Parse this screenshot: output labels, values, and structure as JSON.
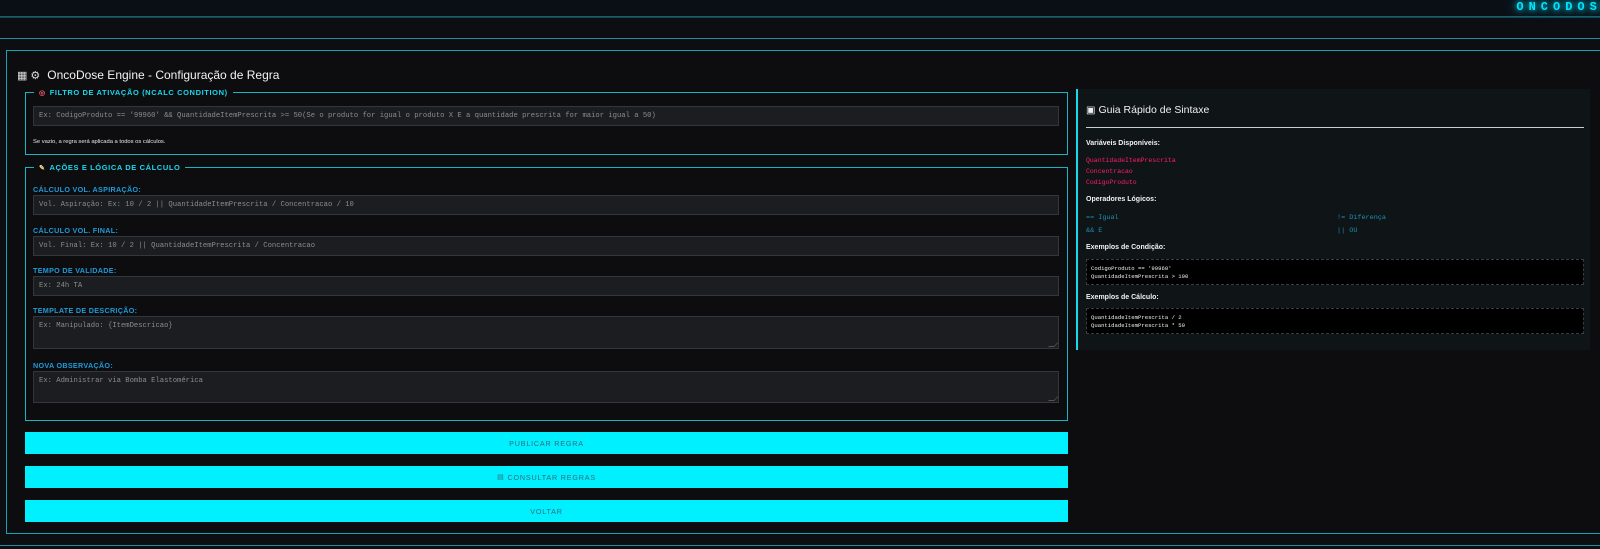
{
  "brand": "ONCODOSE",
  "page": {
    "title": "OncoDose Engine - Configuração de Regra",
    "title_icons": [
      "microchip-icon",
      "gear-icon"
    ]
  },
  "filter": {
    "legend": "FILTRO DE ATIVAÇÃO (NCALC CONDITION)",
    "legend_icon": "target-icon",
    "condition_placeholder": "Ex: CodigoProduto == '99960' && QuantidadeItemPrescrita >= 50(Se o produto for igual o produto X E a quantidade prescrita for maior igual a 50)",
    "hint": "Se vazio, a regra será aplicada a todos os cálculos."
  },
  "actions": {
    "legend": "AÇÕES E LÓGICA DE CÁLCULO",
    "legend_icon": "magic-wand-icon",
    "fields": [
      {
        "label": "CÁLCULO VOL. ASPIRAÇÃO:",
        "placeholder": "Vol. Aspiração: Ex: 10 / 2 || QuantidadeItemPrescrita / Concentracao / 10"
      },
      {
        "label": "CÁLCULO VOL. FINAL:",
        "placeholder": "Vol. Final: Ex: 10 / 2 || QuantidadeItemPrescrita / Concentracao"
      },
      {
        "label": "TEMPO DE VALIDADE:",
        "placeholder": "Ex: 24h TA"
      },
      {
        "label": "TEMPLATE DE DESCRIÇÃO:",
        "placeholder": "Ex: Manipulado: {ItemDescricao}"
      },
      {
        "label": "NOVA OBSERVAÇÃO:",
        "placeholder": "Ex: Administrar via Bomba Elastomérica"
      }
    ]
  },
  "buttons": {
    "publish": "PUBLICAR REGRA",
    "consult": "CONSULTAR REGRAS",
    "consult_icon": "database-icon",
    "back": "VOLTAR"
  },
  "guide": {
    "title": "Guia Rápido de Sintaxe",
    "title_icon": "book-icon",
    "vars_heading": "Variáveis Disponíveis:",
    "vars": [
      "QuantidadeItemPrescrita",
      "Concentracao",
      "CodigoProduto"
    ],
    "ops_heading": "Operadores Lógicos:",
    "ops": [
      "== Igual",
      "!= Diferença",
      "&& E",
      "|| OU"
    ],
    "cond_heading": "Exemplos de Condição:",
    "cond_examples": [
      "CodigoProduto == '99960'",
      "QuantidadeItemPrescrita > 100"
    ],
    "calc_heading": "Exemplos de Cálculo:",
    "calc_examples": [
      "QuantidadeItemPrescrita / 2",
      "QuantidadeItemPrescrita * 50"
    ]
  },
  "colors": {
    "accent": "#00f0ff",
    "border": "#17b4c8",
    "label": "#1e9bd9",
    "variable": "#ff1f5e",
    "background": "#0d0d0f"
  }
}
